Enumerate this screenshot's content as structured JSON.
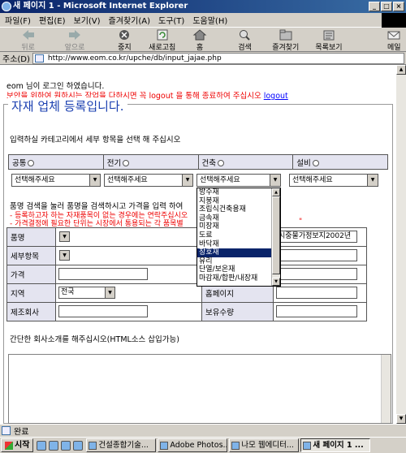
{
  "window": {
    "title": "새 페이지 1 - Microsoft Internet Explorer"
  },
  "menu": [
    "파일(F)",
    "편집(E)",
    "보기(V)",
    "즐겨찾기(A)",
    "도구(T)",
    "도움말(H)"
  ],
  "toolbar": {
    "back": "뒤로",
    "forward": "앞으로",
    "stop": "중지",
    "refresh": "새로고침",
    "home": "홈",
    "search": "검색",
    "favorites": "즐겨찾기",
    "history": "목록보기",
    "mail": "메일"
  },
  "address": {
    "label": "주소(D)",
    "url": "http://www.eom.co.kr/upche/db/input_jajae.php"
  },
  "page": {
    "login_line": "eom 님이 로그인 하였습니다.",
    "security_notice": "보안을 위하여 원하시는 작업을 다하시면 꼭 logout 을 통해 종료하여 주십시오",
    "logout_link": "logout",
    "frame_title": "자재 업체 등록입니다.",
    "category_instruction": "입력하실 카테고리에서 세부 항목을 선택 해 주십시오",
    "categories": [
      {
        "label": "공통",
        "select": "선택해주세요"
      },
      {
        "label": "전기",
        "select": "선택해주세요"
      },
      {
        "label": "건축",
        "select": "선택해주세요"
      },
      {
        "label": "설비",
        "select": "선택해주세요"
      }
    ],
    "search_instruction": "품명 검색을 눌러 품명을 검색하시고 가격을 입력 하여",
    "note1": "- 등록하고자 하는 자재품목이 없는 경우에는 연락주십시오",
    "note2": "- 가격결정에 필요한 단위는 시장에서 통용되는 각 품목별",
    "note2_tail": "\"",
    "fields": {
      "product": "품명",
      "detail": "세부항목",
      "price": "가격",
      "region": "지역",
      "region_value": "전국",
      "manufacturer": "제조회사",
      "source_value": "시중물가정보지2002년",
      "homepage": "홈페이지",
      "quantity": "보유수량"
    },
    "dropdown_items": [
      "방수재",
      "지붕재",
      "조립식건축용재",
      "금속재",
      "미장재",
      "도료",
      "바닥재",
      "창호재",
      "유리",
      "단열/보온재",
      "마감재/합판/내장재"
    ],
    "dropdown_selected": "창호재",
    "intro_label": "간단한 회사소개를 해주십시오(HTML소스 삽입가능)"
  },
  "status": {
    "text": "완료"
  },
  "taskbar": {
    "start": "시작",
    "tasks": [
      "건설종합기술...",
      "Adobe Photos...",
      "나모 웹에디터...",
      "새 페이지 1 ..."
    ]
  }
}
